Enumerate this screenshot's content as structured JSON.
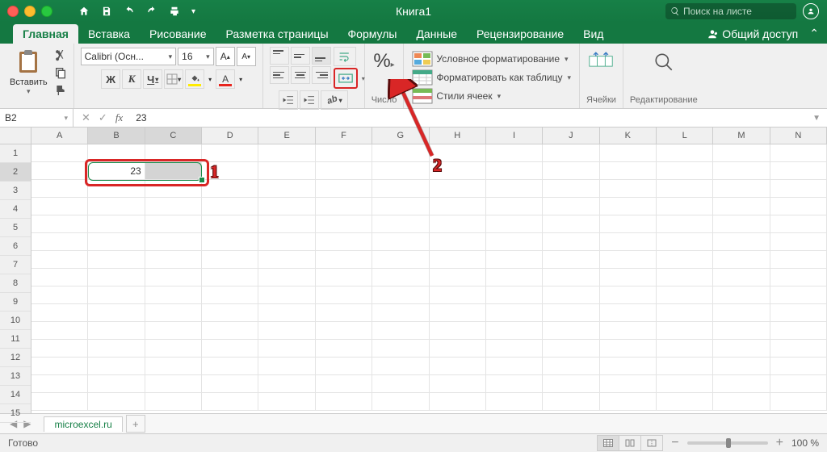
{
  "title": "Книга1",
  "search_placeholder": "Поиск на листе",
  "tabs": {
    "home": "Главная",
    "insert": "Вставка",
    "draw": "Рисование",
    "layout": "Разметка страницы",
    "formulas": "Формулы",
    "data": "Данные",
    "review": "Рецензирование",
    "view": "Вид"
  },
  "share": "Общий доступ",
  "ribbon": {
    "paste": "Вставить",
    "font_name": "Calibri (Осн...",
    "font_size": "16",
    "number": "Число",
    "styles": {
      "cond": "Условное форматирование",
      "table": "Форматировать как таблицу",
      "cell": "Стили ячеек"
    },
    "cells": "Ячейки",
    "editing": "Редактирование"
  },
  "namebox": "B2",
  "formula_value": "23",
  "columns": [
    "A",
    "B",
    "C",
    "D",
    "E",
    "F",
    "G",
    "H",
    "I",
    "J",
    "K",
    "L",
    "M",
    "N"
  ],
  "rows": [
    "1",
    "2",
    "3",
    "4",
    "5",
    "6",
    "7",
    "8",
    "9",
    "10",
    "11",
    "12",
    "13",
    "14",
    "15"
  ],
  "cell_b2": "23",
  "sheet_name": "microexcel.ru",
  "status": "Готово",
  "zoom": "100 %",
  "anno": {
    "one": "1",
    "two": "2"
  }
}
